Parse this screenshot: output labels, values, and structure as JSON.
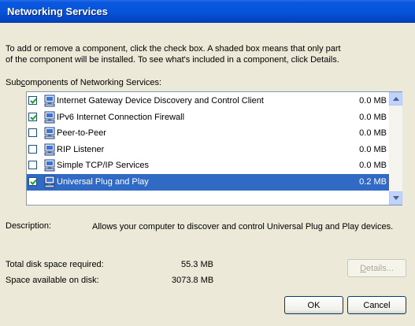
{
  "window": {
    "title": "Networking Services"
  },
  "intro": {
    "line1": "To add or remove a component, click the check box. A shaded box means that only part",
    "line2": "of the component will be installed. To see what's included in a component, click Details."
  },
  "subcomponents": {
    "label_pre": "Sub",
    "label_underlined": "c",
    "label_post": "omponents of Networking Services:",
    "items": [
      {
        "name": "Internet Gateway Device Discovery and Control Client",
        "size": "0.0 MB",
        "checked": true,
        "selected": false
      },
      {
        "name": "IPv6 Internet Connection Firewall",
        "size": "0.0 MB",
        "checked": true,
        "selected": false
      },
      {
        "name": "Peer-to-Peer",
        "size": "0.0 MB",
        "checked": false,
        "selected": false
      },
      {
        "name": "RIP Listener",
        "size": "0.0 MB",
        "checked": false,
        "selected": false
      },
      {
        "name": "Simple TCP/IP Services",
        "size": "0.0 MB",
        "checked": false,
        "selected": false
      },
      {
        "name": "Universal Plug and Play",
        "size": "0.2 MB",
        "checked": true,
        "selected": true
      }
    ]
  },
  "description": {
    "label": "Description:",
    "text": "Allows your computer to discover and control Universal Plug and Play devices."
  },
  "disk": {
    "total_label": "Total disk space required:",
    "total_value": "55.3 MB",
    "available_label": "Space available on disk:",
    "available_value": "3073.8 MB"
  },
  "buttons": {
    "details_underlined": "D",
    "details_rest": "etails...",
    "ok": "OK",
    "cancel": "Cancel"
  },
  "colors": {
    "titlebar": "#0553d8",
    "selection": "#316ac5",
    "dialog_bg": "#ece9d8"
  },
  "icons": {
    "component": "computer-network-icon",
    "scroll_up": "scroll-up-arrow-icon",
    "scroll_down": "scroll-down-arrow-icon"
  }
}
